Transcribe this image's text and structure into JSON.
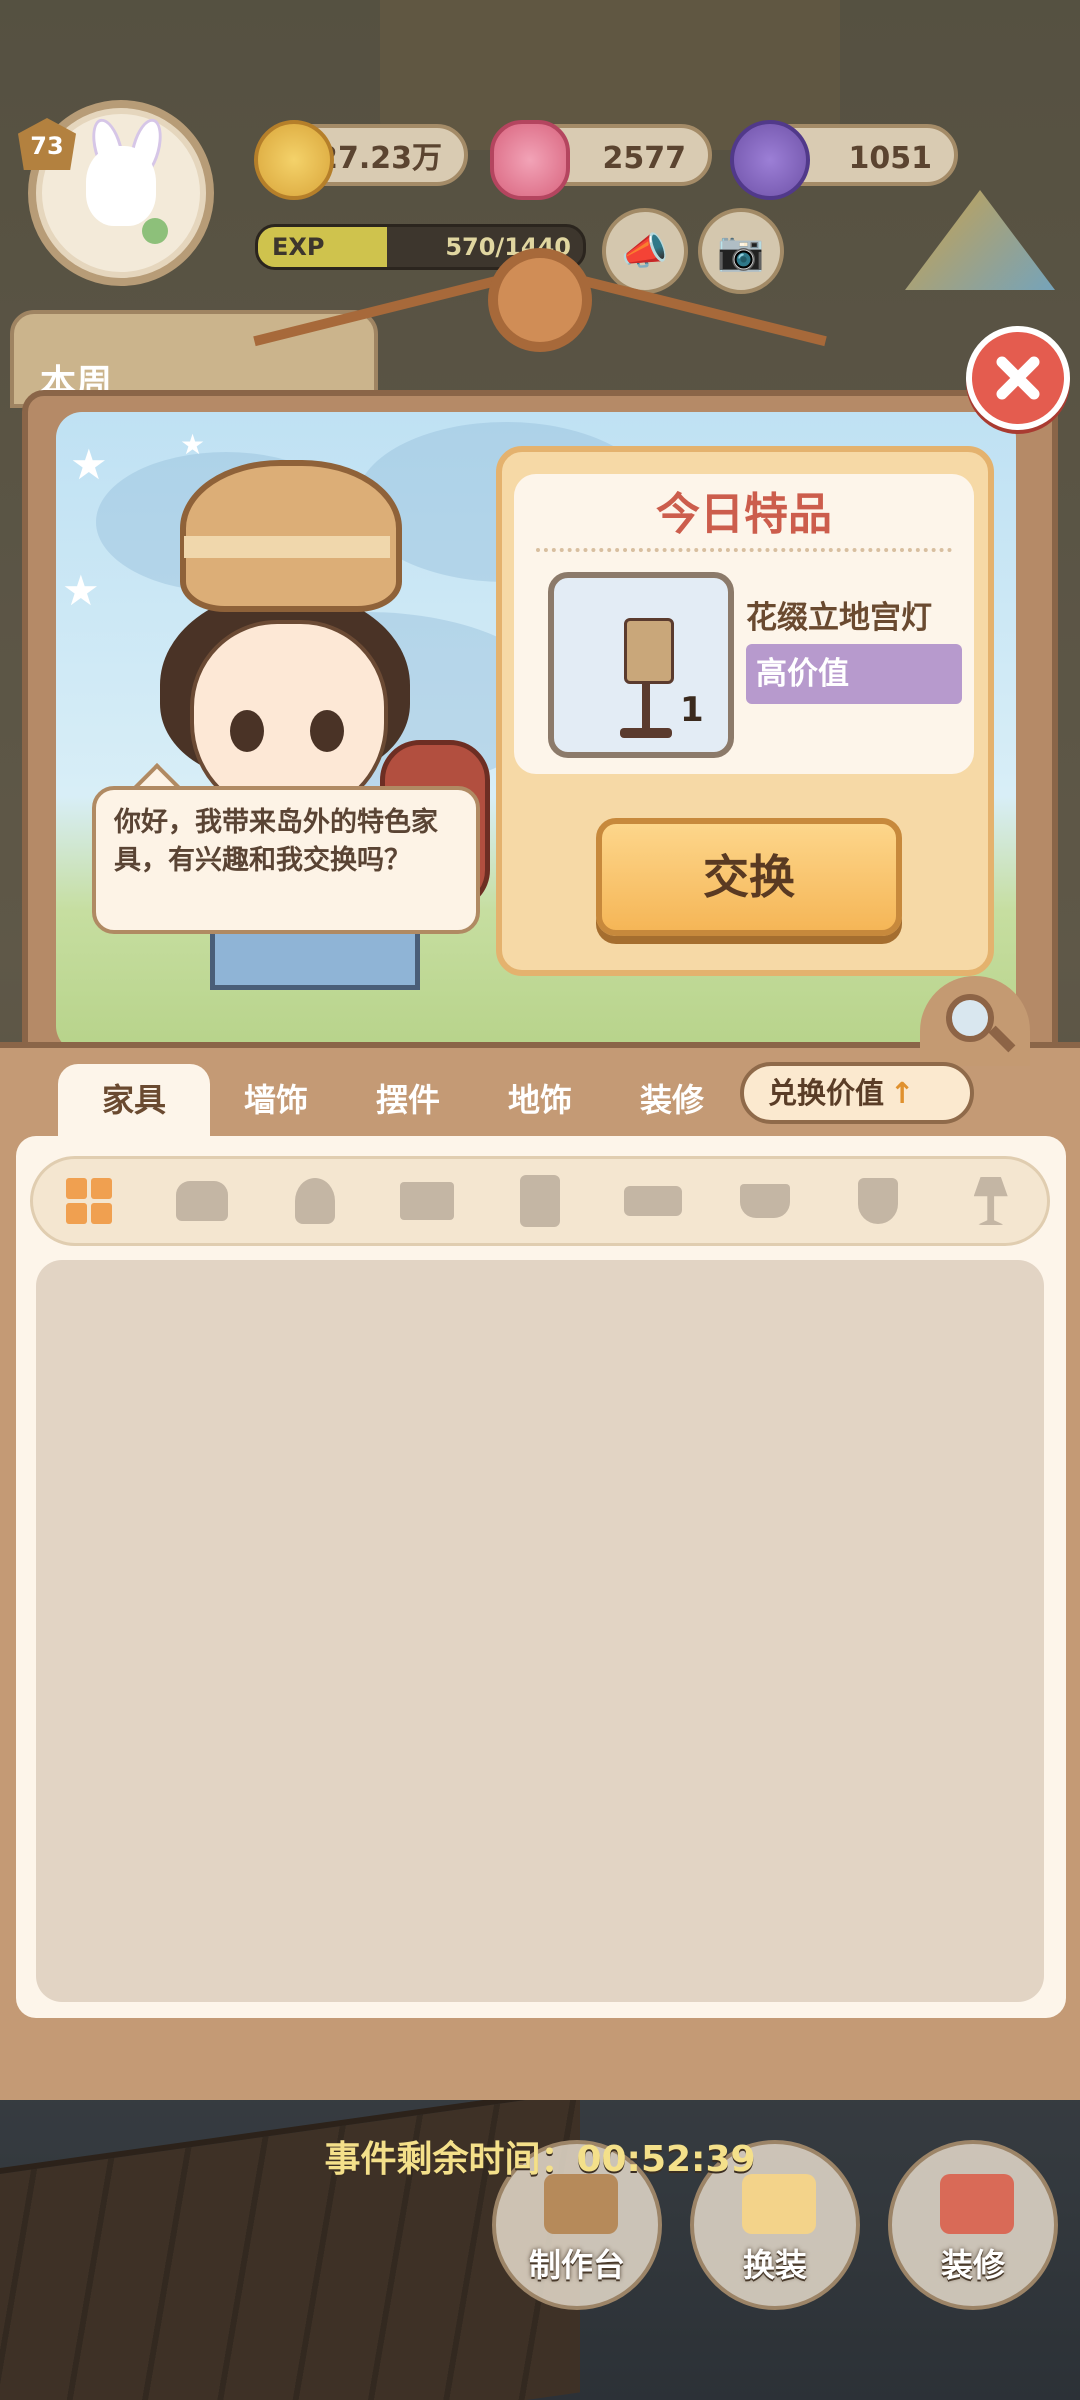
{
  "hud": {
    "level": "73",
    "coins": "27.23万",
    "hearts": "2577",
    "energy": "1051",
    "exp_label": "EXP",
    "exp_text": "570/1440",
    "exp_fraction": 0.396,
    "weekly_label": "本周"
  },
  "merchant": {
    "speech": "你好，我带来岛外的特色家具，有兴趣和我交换吗？"
  },
  "offer": {
    "title": "今日特品",
    "item_name": "花缀立地宫灯",
    "item_count": "1",
    "value_tag": "高价值",
    "exchange_label": "交换"
  },
  "tabs": [
    {
      "label": "家具",
      "active": true
    },
    {
      "label": "墙饰"
    },
    {
      "label": "摆件"
    },
    {
      "label": "地饰"
    },
    {
      "label": "装修"
    }
  ],
  "sort_button": {
    "label": "兑换价值",
    "arrow": "↑"
  },
  "subcategories": [
    "grid-icon",
    "sofa-icon",
    "armchair-icon",
    "desk-icon",
    "cabinet-icon",
    "bed-icon",
    "pot-icon",
    "toilet-icon",
    "lamp-icon"
  ],
  "timer": "事件剩余时间：00:52:39",
  "dock": {
    "craft": "制作台",
    "outfit": "换装",
    "decorate": "装修"
  },
  "colors": {
    "close": "#e45c4f",
    "offer_title": "#cc5d4c",
    "value_tag": "#b79acd",
    "exchange_button": "#f5b657",
    "timer": "#f4e08a"
  }
}
